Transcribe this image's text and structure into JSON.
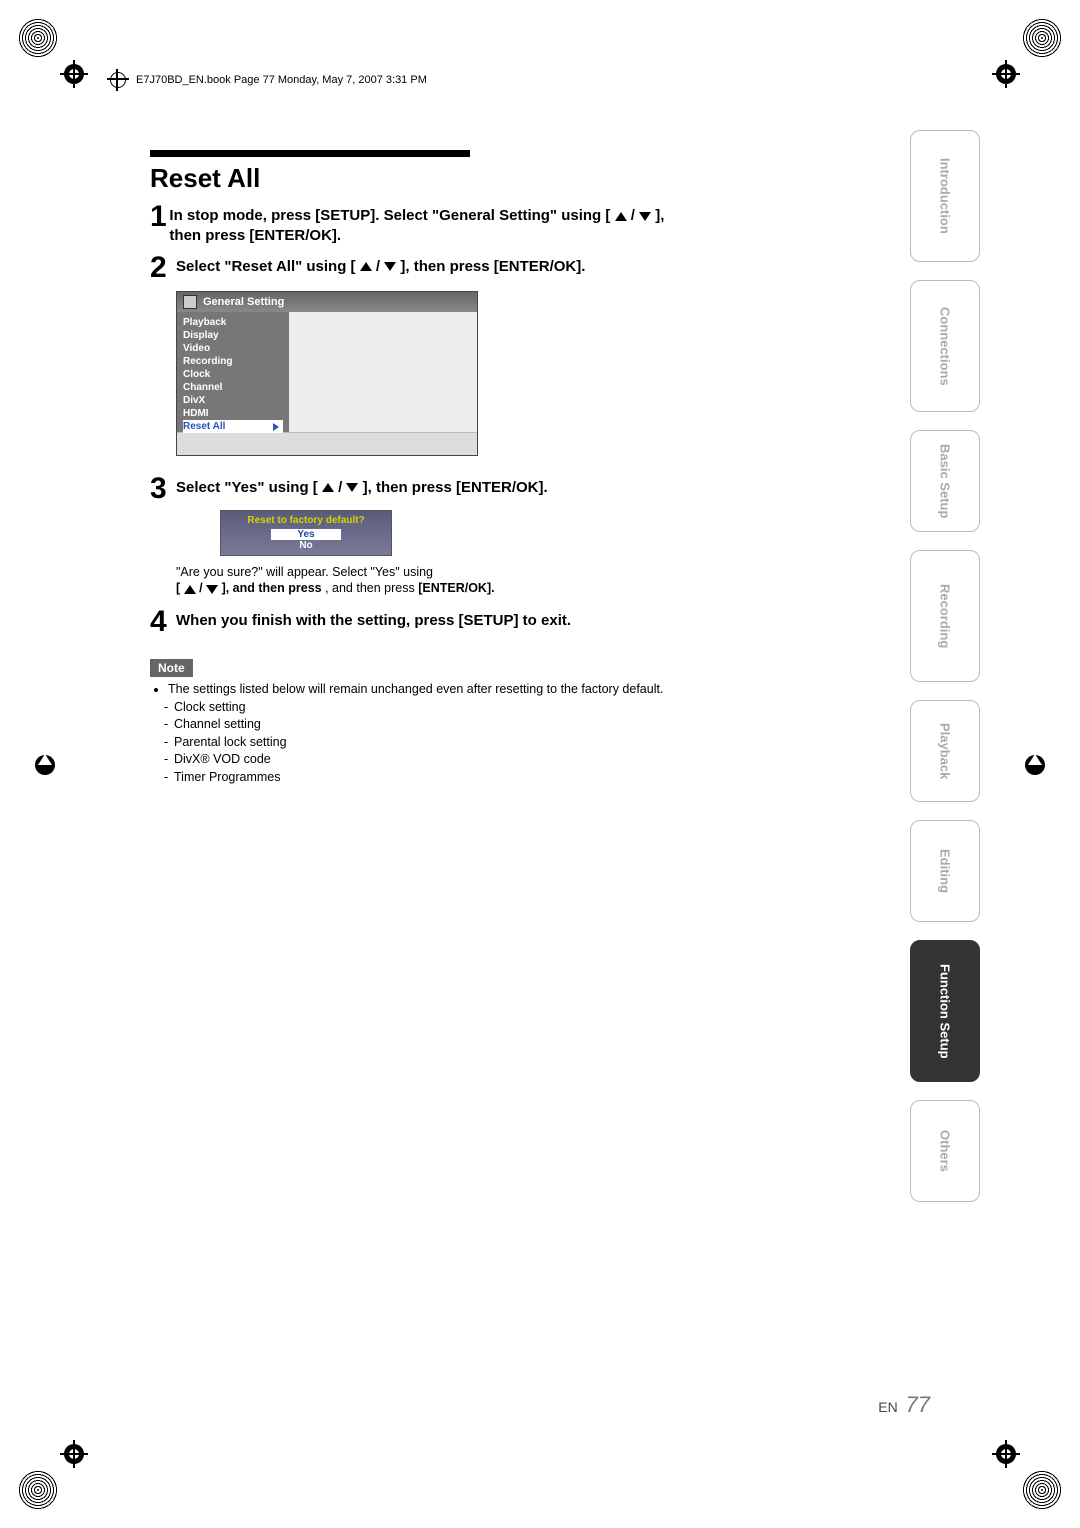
{
  "header_line": "E7J70BD_EN.book  Page 77  Monday, May 7, 2007  3:31 PM",
  "title": "Reset All",
  "steps": {
    "s1_a": "In stop mode, press [SETUP]. Select \"General Setting\" using [",
    "s1_b": " / ",
    "s1_c": "], then press [ENTER/OK].",
    "s2_a": "Select \"Reset All\" using [",
    "s2_b": " / ",
    "s2_c": "], then press [ENTER/OK].",
    "s3_a": "Select \"Yes\" using [",
    "s3_b": " / ",
    "s3_c": "], then press [ENTER/OK].",
    "s4": "When you finish with the setting, press [SETUP] to exit."
  },
  "osd": {
    "title": "General Setting",
    "items": [
      "Playback",
      "Display",
      "Video",
      "Recording",
      "Clock",
      "Channel",
      "DivX",
      "HDMI"
    ],
    "selected": "Reset All"
  },
  "dialog": {
    "title": "Reset to factory default?",
    "yes": "Yes",
    "no": "No"
  },
  "explain_a": "\"Are you sure?\" will appear. Select \"Yes\" using ",
  "explain_b": "[",
  "explain_c": " / ",
  "explain_d": "], and then press ",
  "explain_e": "[ENTER/OK].",
  "note_label": "Note",
  "notes": {
    "intro": "The settings listed below will remain unchanged even after resetting to the factory default.",
    "items": [
      "Clock setting",
      "Channel setting",
      "Parental lock setting",
      "DivX® VOD code",
      "Timer Programmes"
    ]
  },
  "tabs": [
    "Introduction",
    "Connections",
    "Basic Setup",
    "Recording",
    "Playback",
    "Editing",
    "Function Setup",
    "Others"
  ],
  "active_tab": "Function Setup",
  "page_label": "EN",
  "page_number": "77"
}
